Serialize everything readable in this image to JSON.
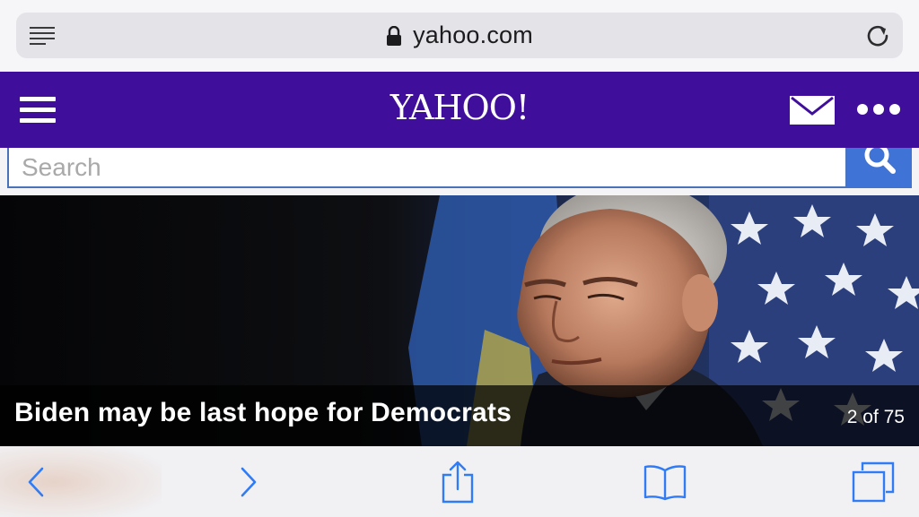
{
  "browser": {
    "url": "yahoo.com",
    "icons": {
      "reader": "reader-view-icon",
      "lock": "lock-icon",
      "reload": "reload-icon"
    }
  },
  "header": {
    "logo": "YAHOO!",
    "background_color": "#3f0f9c",
    "icons": {
      "menu": "hamburger-menu-icon",
      "mail": "mail-icon",
      "more": "more-dots-icon"
    }
  },
  "search": {
    "placeholder": "Search",
    "button_color": "#3f73d6",
    "icon": "search-icon"
  },
  "hero": {
    "headline": "Biden may be last hope for Democrats",
    "counter": "2 of 75"
  },
  "toolbar": {
    "accent_color": "#2f7cf6",
    "icons": [
      "back-icon",
      "forward-icon",
      "share-icon",
      "bookmarks-icon",
      "tabs-icon"
    ]
  }
}
